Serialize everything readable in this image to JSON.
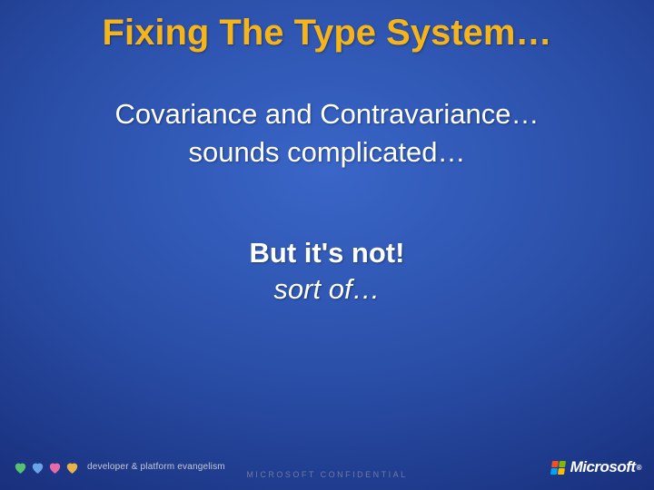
{
  "title": "Fixing The Type System…",
  "body": {
    "line1": "Covariance and Contravariance…",
    "line2": "sounds complicated…"
  },
  "emphasis": {
    "bold": "But it's not!",
    "italic": "sort of…"
  },
  "footer": {
    "dpe_label": "developer & platform evangelism",
    "confidential": "MICROSOFT CONFIDENTIAL",
    "ms_brand": "Microsoft",
    "ms_reg": "®"
  },
  "colors": {
    "title": "#f4b41a",
    "text": "#ffffff"
  }
}
